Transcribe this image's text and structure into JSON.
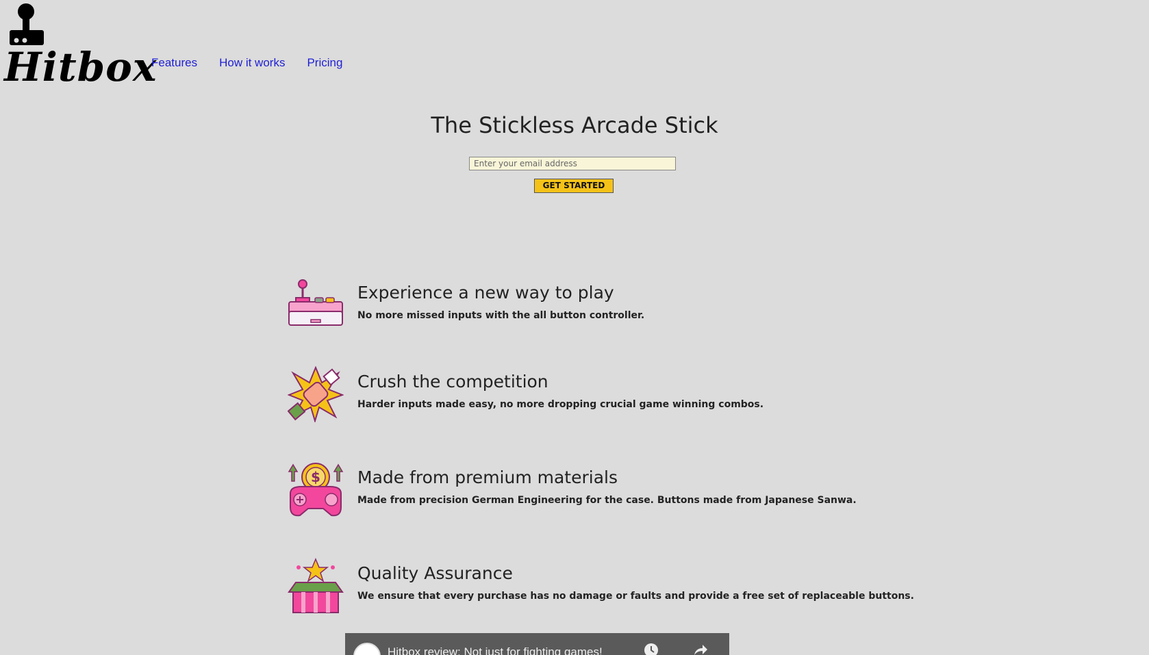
{
  "brand": {
    "name": "Hitbox"
  },
  "nav": {
    "items": [
      {
        "label": "Features"
      },
      {
        "label": "How it works"
      },
      {
        "label": "Pricing"
      }
    ]
  },
  "hero": {
    "title": "The Stickless Arcade Stick",
    "email_placeholder": "Enter your email address",
    "cta_label": "GET STARTED"
  },
  "features": [
    {
      "title": "Experience a new way to play",
      "description": "No more missed inputs with the all button controller.",
      "icon": "arcade-controller-icon"
    },
    {
      "title": "Crush the competition",
      "description": "Harder inputs made easy, no more dropping crucial game winning combos.",
      "icon": "fist-burst-icon"
    },
    {
      "title": "Made from premium materials",
      "description": "Made from precision German Engineering for the case. Buttons made from Japanese Sanwa.",
      "icon": "gamepad-coin-icon"
    },
    {
      "title": "Quality Assurance",
      "description": "We ensure that every purchase has no damage or faults and provide a free set of replaceable buttons.",
      "icon": "gift-box-star-icon"
    }
  ],
  "video": {
    "title": "Hitbox review: Not just for fighting games!"
  },
  "colors": {
    "background": "#dcdcdc",
    "link": "#1f1fd6",
    "cta": "#f5c218",
    "input_bg": "#f8f5d8"
  }
}
